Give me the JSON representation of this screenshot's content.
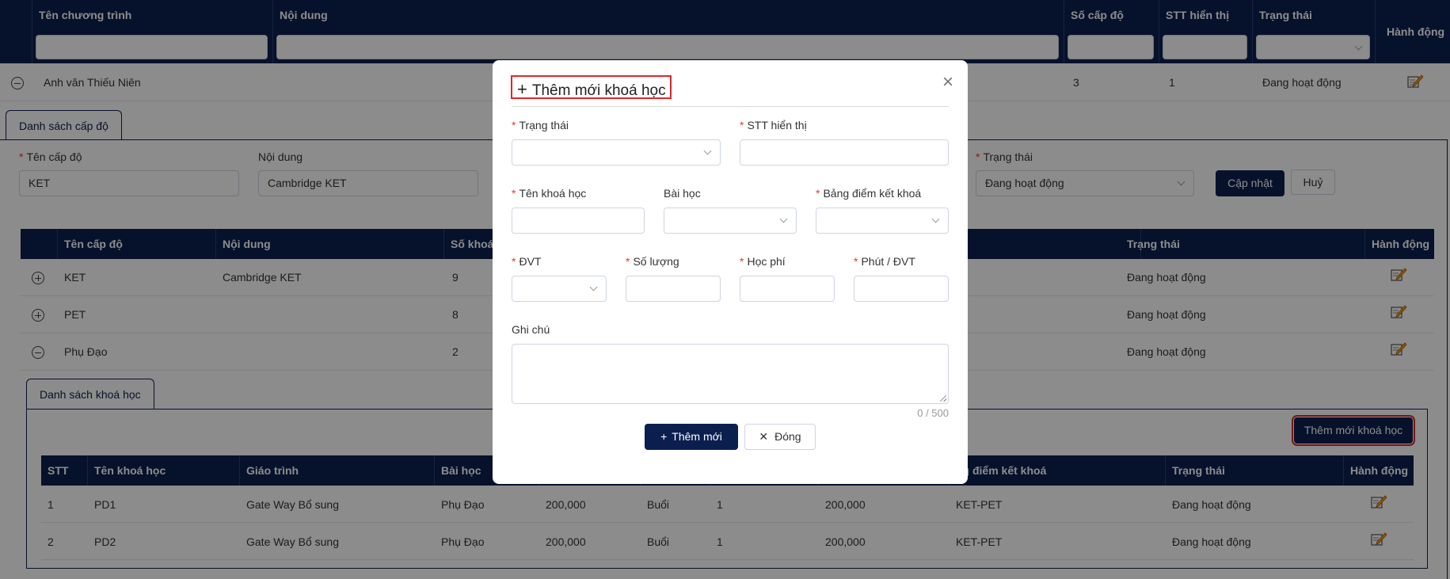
{
  "programs_table": {
    "columns": [
      "Tên chương trình",
      "Nội dung",
      "Số cấp độ",
      "STT hiển thị",
      "Trạng thái",
      "Hành động"
    ],
    "row": {
      "name": "Anh văn Thiếu Niên",
      "levels": "3",
      "order": "1",
      "status": "Đang hoạt động"
    }
  },
  "levels_tab": "Danh sách cấp độ",
  "level_form": {
    "name_label": "Tên cấp độ",
    "name_value": "KET",
    "content_label": "Nội dung",
    "content_value": "Cambridge KET",
    "status_label": "Trạng thái",
    "status_value": "Đang hoạt động",
    "update_button": "Cập nhật",
    "cancel_button": "Huỷ"
  },
  "levels_table": {
    "columns": [
      "Tên cấp độ",
      "Nội dung",
      "Số khoá",
      "Trạng thái",
      "Hành động"
    ],
    "rows": [
      {
        "name": "KET",
        "content": "Cambridge KET",
        "count": "9",
        "status": "Đang hoạt động"
      },
      {
        "name": "PET",
        "content": "",
        "count": "8",
        "status": "Đang hoạt động"
      },
      {
        "name": "Phụ Đạo",
        "content": "",
        "count": "2",
        "status": "Đang hoạt động"
      }
    ]
  },
  "courses_tab": "Danh sách khoá học",
  "add_course_button": "Thêm mới khoá học",
  "courses_table": {
    "columns": [
      "STT",
      "Tên khoá học",
      "Giáo trình",
      "Bài học",
      "",
      "",
      "",
      "",
      "ng điểm kết khoá",
      "Trạng thái",
      "Hành động"
    ],
    "rows": [
      {
        "stt": "1",
        "name": "PD1",
        "book": "Gate Way Bổ sung",
        "lesson": "Phụ Đạo",
        "fee": "200,000",
        "unit": "Buổi",
        "qty": "1",
        "total": "200,000",
        "score": "KET-PET",
        "status": "Đang hoạt động"
      },
      {
        "stt": "2",
        "name": "PD2",
        "book": "Gate Way Bổ sung",
        "lesson": "Phụ Đạo",
        "fee": "200,000",
        "unit": "Buổi",
        "qty": "1",
        "total": "200,000",
        "score": "KET-PET",
        "status": "Đang hoạt động"
      }
    ]
  },
  "modal": {
    "title_icon": "+",
    "title": "Thêm mới khoá học",
    "close_icon": "×",
    "fields": {
      "status": "Trạng thái",
      "order": "STT hiển thị",
      "course_name": "Tên khoá học",
      "lesson": "Bài học",
      "score_table": "Bảng điểm kết khoá",
      "unit": "ĐVT",
      "quantity": "Số lượng",
      "fee": "Học phí",
      "minutes": "Phút / ĐVT",
      "note": "Ghi chú"
    },
    "note_counter": "0 / 500",
    "add_button": "Thêm mới",
    "close_button": "Đóng"
  },
  "colors": {
    "navy": "#0b1f4f",
    "highlight": "#e0262a",
    "required": "#e53935"
  }
}
